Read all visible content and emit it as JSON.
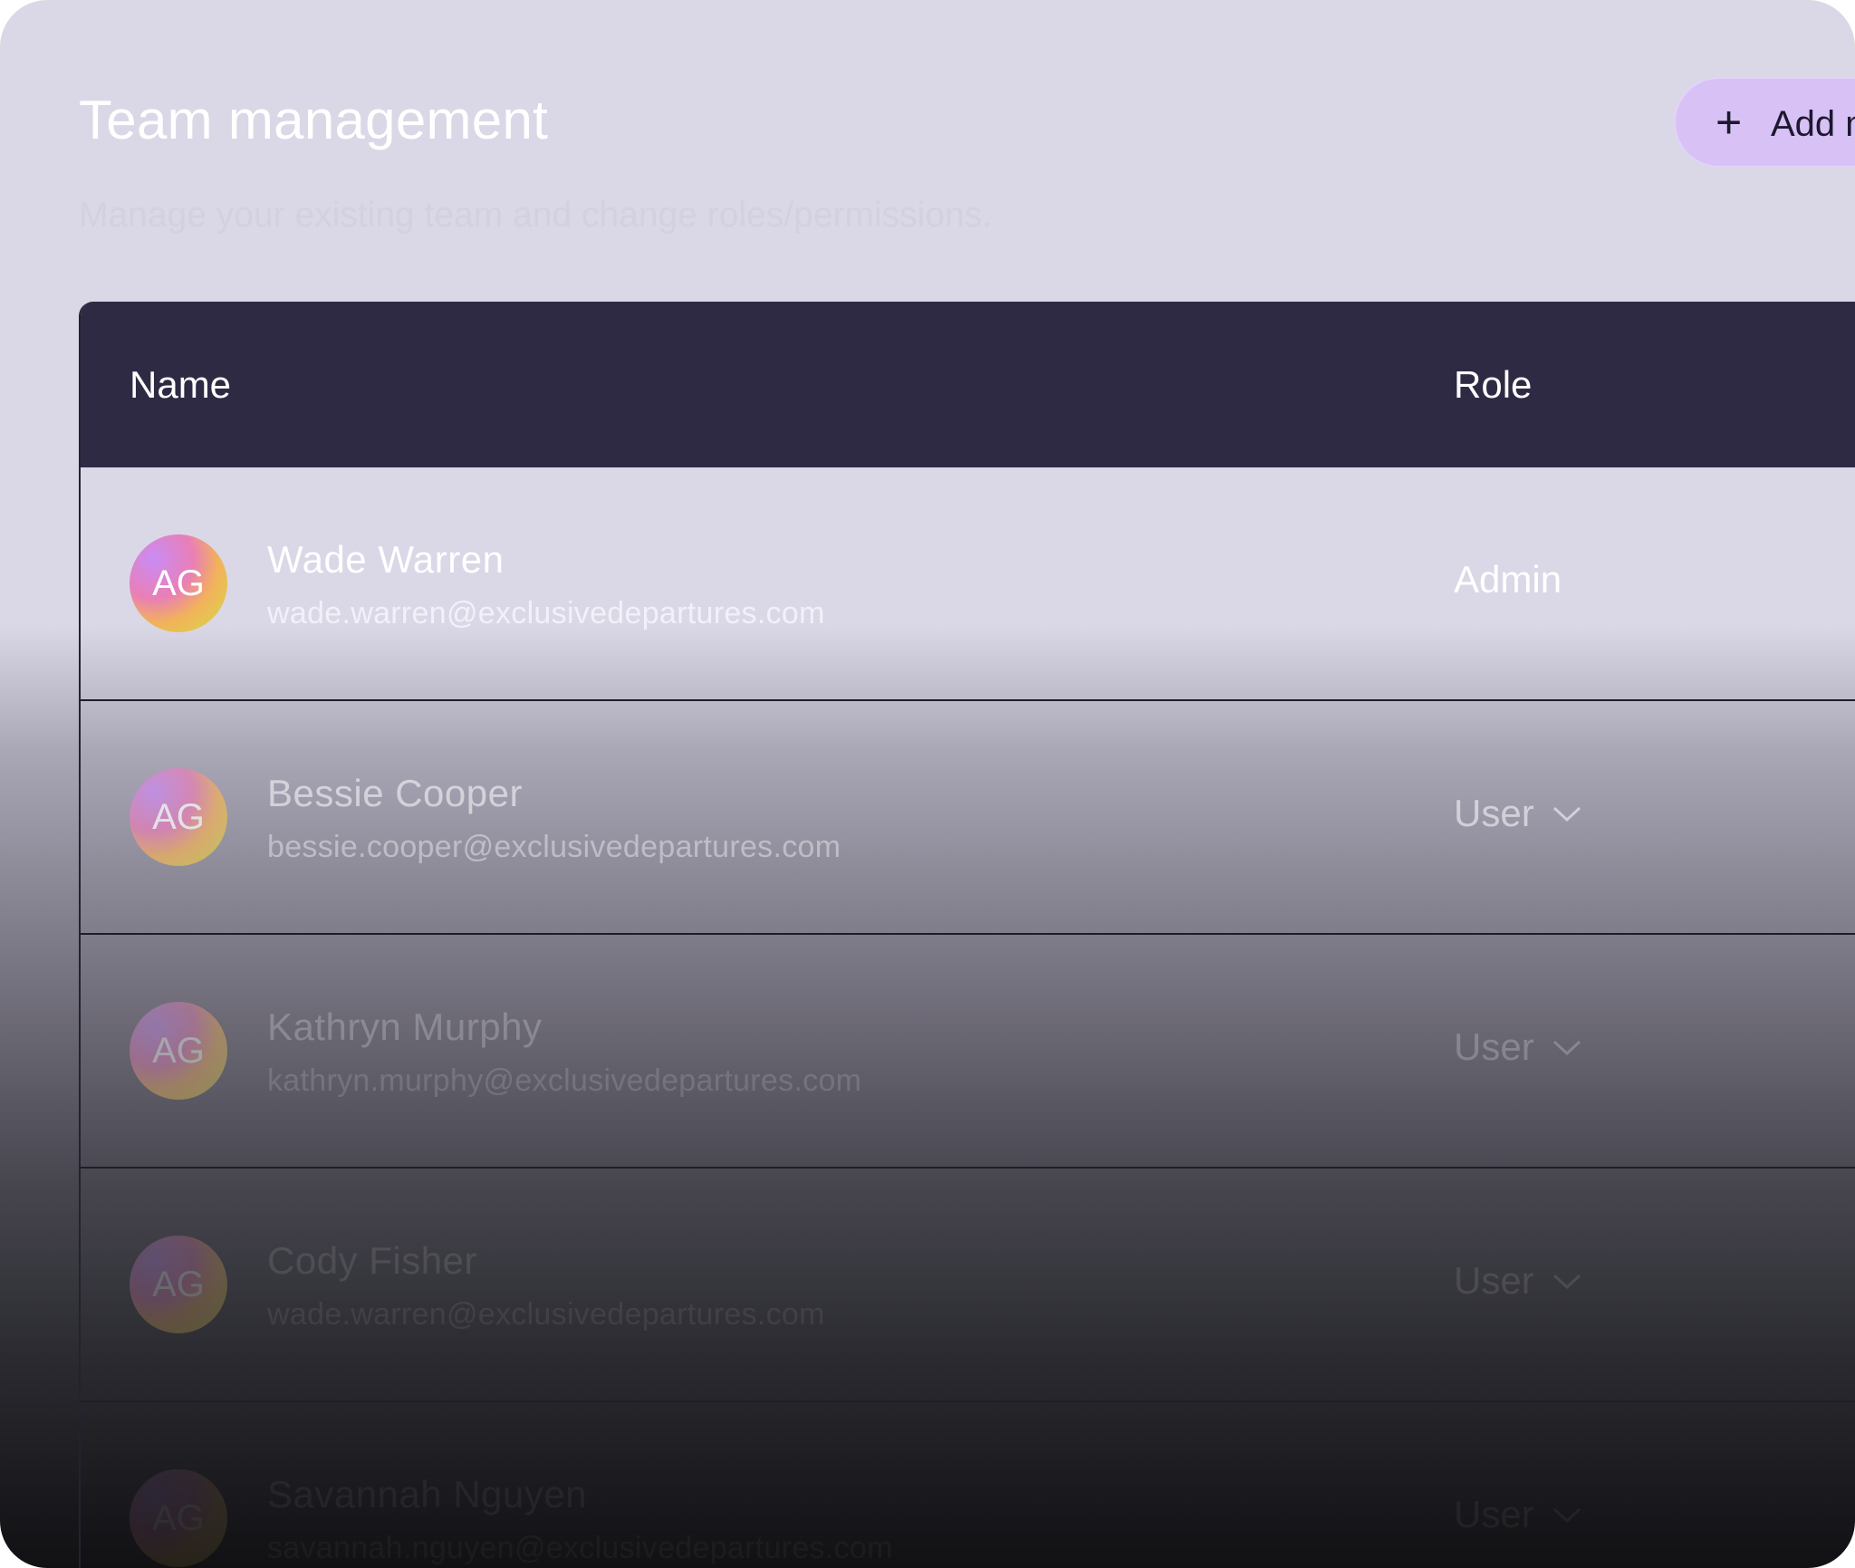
{
  "header": {
    "title": "Team management",
    "subtitle": "Manage your existing team and change roles/permissions.",
    "add_button": {
      "icon": "plus-icon",
      "label": "Add member"
    }
  },
  "table": {
    "columns": {
      "name": "Name",
      "role": "Role"
    },
    "rows": [
      {
        "initials": "AG",
        "name": "Wade Warren",
        "email": "wade.warren@exclusivedepartures.com",
        "role": "Admin"
      },
      {
        "initials": "AG",
        "name": "Bessie Cooper",
        "email": "bessie.cooper@exclusivedepartures.com",
        "role": "User",
        "role_icon": "chevron-down-icon"
      },
      {
        "initials": "AG",
        "name": "Kathryn Murphy",
        "email": "kathryn.murphy@exclusivedepartures.com",
        "role": "User",
        "role_icon": "chevron-down-icon"
      },
      {
        "initials": "AG",
        "name": "Cody Fisher",
        "email": "wade.warren@exclusivedepartures.com",
        "role": "User",
        "role_icon": "chevron-down-icon"
      },
      {
        "initials": "AG",
        "name": "Savannah Nguyen",
        "email": "savannah.nguyen@exclusivedepartures.com",
        "role": "User",
        "role_icon": "chevron-down-icon"
      }
    ]
  },
  "colors": {
    "background_top": "#dad8e6",
    "background_bottom": "#111114",
    "table_header": "#2f2a44",
    "add_button": "#d7c1f5",
    "text": "#ffffff"
  }
}
